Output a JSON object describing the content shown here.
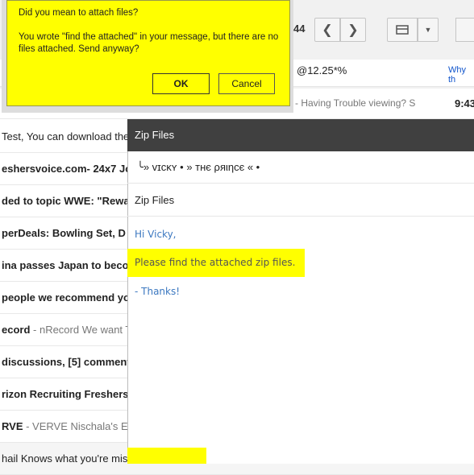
{
  "toolbar": {
    "page_count": "44",
    "prev_icon": "chevron-left-icon",
    "next_icon": "chevron-right-icon",
    "layout_icon": "layout-icon",
    "ad_text": "@12.25*%",
    "ad_link": "Why th"
  },
  "inbox": {
    "row0": {
      "snippet": "- Having Trouble viewing? S",
      "time": "9:43"
    },
    "rows": [
      {
        "sender": "Test, You can download the",
        "snippet": ""
      },
      {
        "sender": "eshersvoice.com- 24x7 Jo",
        "snippet": ""
      },
      {
        "sender": "ded to topic WWE: \"Rewa",
        "snippet": ""
      },
      {
        "sender": "perDeals: Bowling Set, D",
        "snippet": ""
      },
      {
        "sender": "ina passes Japan to beco",
        "snippet": ""
      },
      {
        "sender": "people we recommend yo",
        "snippet": ""
      },
      {
        "sender": "ecord",
        "snippet": " - nRecord We want T"
      },
      {
        "sender": "discussions, [5] comment",
        "snippet": ""
      },
      {
        "sender": "rizon Recruiting Freshers",
        "snippet": ""
      },
      {
        "sender": "RVE",
        "snippet": " - VERVE Nischala's E"
      },
      {
        "sender": "hail Knows what you're miss",
        "snippet": ""
      }
    ]
  },
  "panel": {
    "title": "Zip Files",
    "to": "╰» vɪᴄκʏ • » тнє ρяιηcє « •",
    "subject": "Zip Files",
    "greeting": "Hi Vicky,",
    "body": "Please find the attached zip files.",
    "signoff": "- Thanks!"
  },
  "dialog": {
    "title": "Did you mean to attach files?",
    "message": "You wrote \"find the attached\" in your message, but there are no files attached.  Send anyway?",
    "ok_label": "OK",
    "cancel_label": "Cancel",
    "background_color": "#ffff00"
  }
}
